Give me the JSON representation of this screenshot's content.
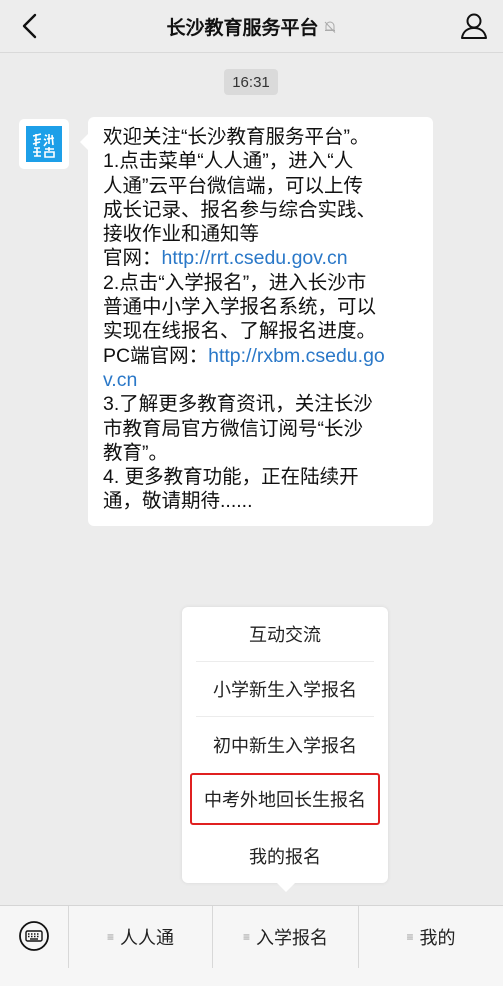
{
  "header": {
    "title": "长沙教育服务平台",
    "back_icon": "chevron-left-icon",
    "mute_icon": "bell-slash-icon",
    "profile_icon": "person-icon"
  },
  "chat": {
    "time": "16:31",
    "avatar_icon": "changsha-education-logo-icon",
    "message": {
      "l1": "欢迎关注“长沙教育服务平台”。",
      "l2": "1.点击菜单“人人通”，进入“人",
      "l3": "人通”云平台微信端，可以上传",
      "l4": "成长记录、报名参与综合实践、",
      "l5": "接收作业和通知等",
      "l6_prefix": "官网：",
      "l6_link": "http://rrt.csedu.gov.cn",
      "l7": "2.点击“入学报名”，进入长沙市",
      "l8": "普通中小学入学报名系统，可以",
      "l9": "实现在线报名、了解报名进度。",
      "l10_prefix": "PC端官网：",
      "l10_link": "http://rxbm.csedu.go",
      "l11_link": "v.cn",
      "l12": "3.了解更多教育资讯，关注长沙",
      "l13": "市教育局官方微信订阅号“长沙",
      "l14": "教育”。",
      "l15": "4. 更多教育功能，正在陆续开",
      "l16": "通，敬请期待......"
    }
  },
  "popup_menu": {
    "items": [
      "互动交流",
      "小学新生入学报名",
      "初中新生入学报名",
      "中考外地回长生报名",
      "我的报名"
    ],
    "highlight_color": "#e02020"
  },
  "bottom_bar": {
    "keyboard_icon": "keyboard-icon",
    "menu_mark": "≡",
    "tabs": [
      "人人通",
      "入学报名",
      "我的"
    ]
  },
  "colors": {
    "link": "#2a78c8",
    "background": "#ececec",
    "avatar_brand": "#1d9fe8"
  }
}
